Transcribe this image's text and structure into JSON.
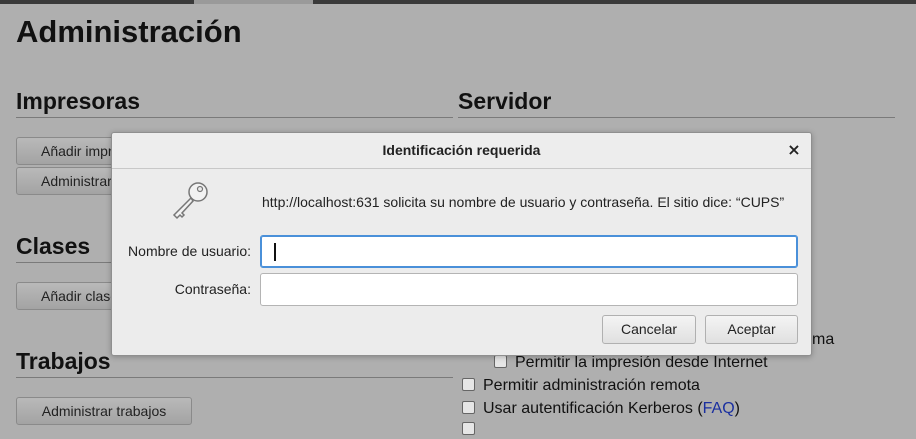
{
  "page": {
    "title": "Administración"
  },
  "sections": {
    "printers": {
      "title": "Impresoras",
      "buttons": [
        "Añadir impresora",
        "Administrar impresoras"
      ]
    },
    "server": {
      "title": "Servidor"
    },
    "classes": {
      "title": "Clases",
      "buttons": [
        "Añadir clase"
      ]
    },
    "jobs": {
      "title": "Trabajos",
      "buttons": [
        "Administrar trabajos"
      ]
    }
  },
  "server_options": {
    "share_tail": "ma",
    "internet": "Permitir la impresión desde Internet",
    "remote": "Permitir administración remota",
    "kerberos_prefix": "Usar autentificación Kerberos (",
    "kerberos_link": "FAQ",
    "kerberos_suffix": ")"
  },
  "dialog": {
    "title": "Identificación requerida",
    "close_glyph": "×",
    "message": "http://localhost:631 solicita su nombre de usuario y contraseña. El sitio dice: “CUPS”",
    "username_label": "Nombre de usuario:",
    "username_value": "",
    "password_label": "Contraseña:",
    "password_value": "",
    "cancel_label": "Cancelar",
    "accept_label": "Aceptar",
    "icon": "key-icon"
  }
}
